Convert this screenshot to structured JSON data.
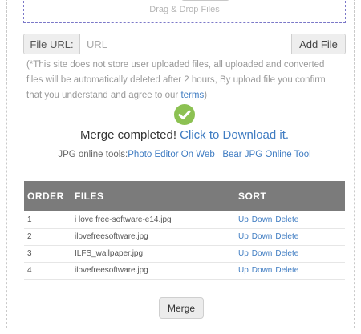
{
  "upload": {
    "drop_text": "Drag & Drop Files",
    "url_label": "File URL:",
    "url_placeholder": "URL",
    "add_file_label": "Add File"
  },
  "notice": {
    "text": "(*This site does not store user uploaded files, all uploaded and converted files will be automatically deleted after 2 hours, By upload file you confirm that you understand and agree to our ",
    "terms_link": "terms",
    "close": ")"
  },
  "status": {
    "icon": "check-circle-icon",
    "icon_color": "#8cc152",
    "message": "Merge completed!",
    "download_link": "Click to Download it."
  },
  "tools": {
    "label": "JPG online tools:",
    "links": [
      "Photo Editor On Web",
      "Bear JPG Online Tool"
    ]
  },
  "table": {
    "headers": [
      "ORDER",
      "FILES",
      "SORT"
    ],
    "rows": [
      {
        "order": "1",
        "file": "i love free-software-e14.jpg",
        "actions": [
          "Up",
          "Down",
          "Delete"
        ]
      },
      {
        "order": "2",
        "file": "ilovefreesoftware.jpg",
        "actions": [
          "Up",
          "Down",
          "Delete"
        ]
      },
      {
        "order": "3",
        "file": "ILFS_wallpaper.jpg",
        "actions": [
          "Up",
          "Down",
          "Delete"
        ]
      },
      {
        "order": "4",
        "file": "ilovefreesoftware.jpg",
        "actions": [
          "Up",
          "Down",
          "Delete"
        ]
      }
    ]
  },
  "merge_button": "Merge",
  "colors": {
    "link": "#3f7cc2",
    "table_header_bg": "#7b7b7b",
    "drop_zone_border": "#7b78c8"
  }
}
